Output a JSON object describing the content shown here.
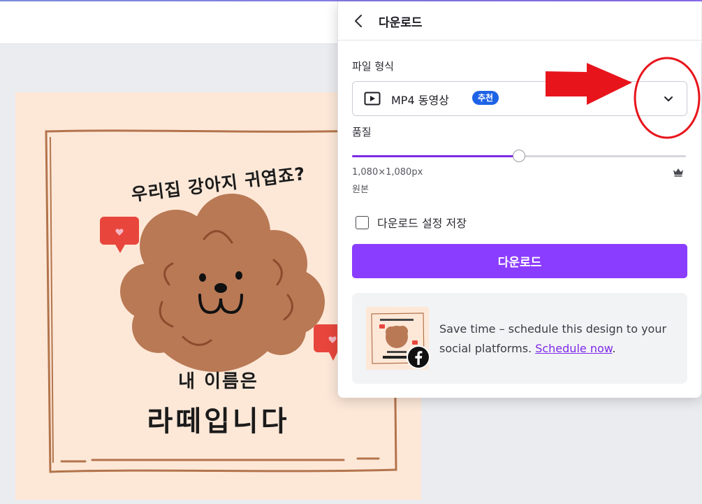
{
  "design": {
    "headline": "우리집 강아지 귀엽죠?",
    "name_line1": "내 이름은",
    "name_line2": "라떼입니다"
  },
  "panel": {
    "title": "다운로드",
    "back_icon": "chevron-left-icon",
    "file_type_label": "파일 형식",
    "file_type_value": "MP4 동영상",
    "file_type_icon": "video-play-icon",
    "recommended_badge": "추천",
    "dropdown_icon": "chevron-down-icon",
    "quality_label": "품질",
    "quality_fraction": 0.5,
    "resolution": "1,080×1,080px",
    "resolution_note": "원본",
    "premium_icon": "crown-icon",
    "save_settings_label": "다운로드 설정 저장",
    "save_settings_checked": false,
    "download_button": "다운로드",
    "promo": {
      "text": "Save time – schedule this design to your social platforms.",
      "link": "Schedule now",
      "trailing": ".",
      "icon": "facebook-icon"
    }
  },
  "colors": {
    "accent": "#8b3dff",
    "badge": "#1e63e6",
    "design_background": "#fde8d8",
    "annotation": "#e8141c"
  }
}
